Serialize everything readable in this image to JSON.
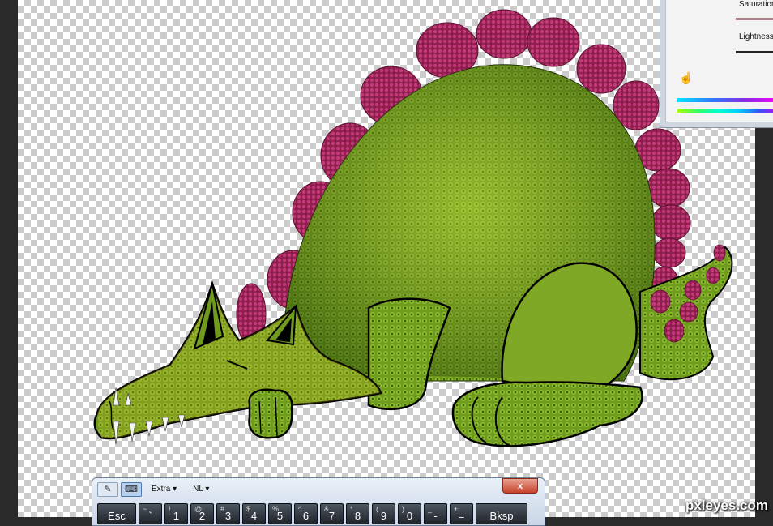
{
  "hue_saturation_panel": {
    "saturation_label": "Saturation:",
    "lightness_label": "Lightness:",
    "hand_icon": "hand-tool-icon"
  },
  "keyboard": {
    "extra_label": "Extra",
    "language_label": "NL",
    "close_symbol": "x",
    "keys": [
      {
        "top": "",
        "main": "Esc"
      },
      {
        "top": "~",
        "main": "`"
      },
      {
        "top": "!",
        "main": "1"
      },
      {
        "top": "@",
        "main": "2"
      },
      {
        "top": "#",
        "main": "3"
      },
      {
        "top": "$",
        "main": "4"
      },
      {
        "top": "%",
        "main": "5"
      },
      {
        "top": "^",
        "main": "6"
      },
      {
        "top": "&",
        "main": "7"
      },
      {
        "top": "*",
        "main": "8"
      },
      {
        "top": "(",
        "main": "9"
      },
      {
        "top": ")",
        "main": "0"
      },
      {
        "top": "_",
        "main": "-"
      },
      {
        "top": "+",
        "main": "="
      },
      {
        "top": "",
        "main": "Bksp"
      }
    ]
  },
  "watermark": "pxleyes.com",
  "colors": {
    "dragon_body": "#6f9a1e",
    "dragon_spikes": "#a3245a",
    "outline": "#000000"
  }
}
